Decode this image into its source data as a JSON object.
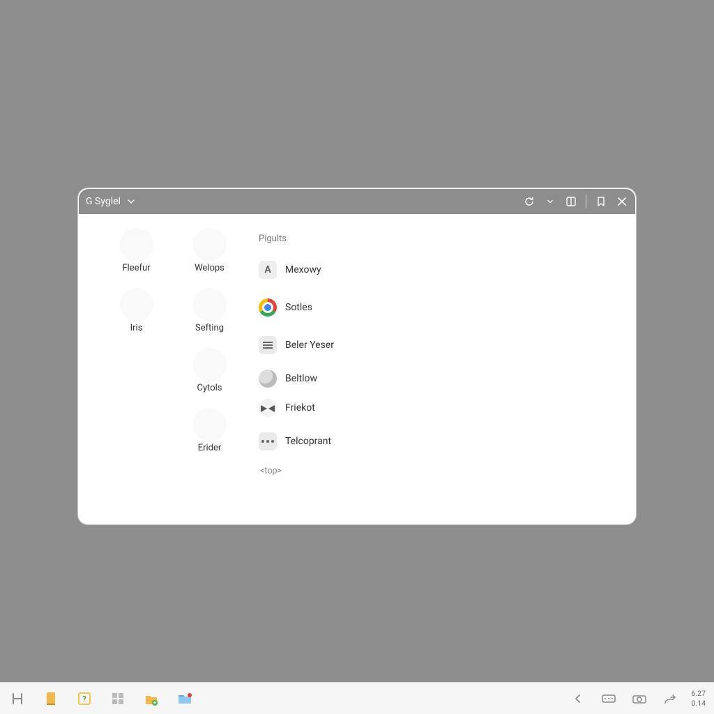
{
  "window": {
    "title": "G Syglel",
    "left_grid": [
      {
        "label": "Fleefur"
      },
      {
        "label": "Welops"
      },
      {
        "label": "Iris"
      },
      {
        "label": "Sefting"
      },
      {
        "label": ""
      },
      {
        "label": "Cytols"
      },
      {
        "label": ""
      },
      {
        "label": "Erider"
      }
    ],
    "section_heading": "Pigults",
    "list": [
      {
        "label": "Mexowy",
        "icon": "letter-a"
      },
      {
        "label": "Sotles",
        "icon": "chrome"
      },
      {
        "label": "Beler Yeser",
        "icon": "doc"
      },
      {
        "label": "Beltlow",
        "icon": "globe"
      },
      {
        "label": "Friekot",
        "icon": "bowtie"
      },
      {
        "label": "Telcoprant",
        "icon": "dots"
      }
    ],
    "footer_tag": "<top>"
  },
  "taskbar": {
    "clock_line1": "6.27",
    "clock_line2": "0.14"
  }
}
